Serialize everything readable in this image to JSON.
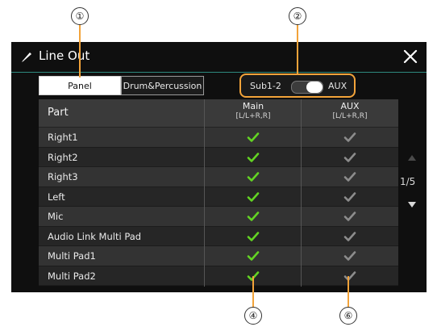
{
  "window": {
    "title": "Line Out",
    "title_icon": "pen-icon",
    "close_icon": "close-icon"
  },
  "tabs": [
    {
      "label": "Panel",
      "active": true
    },
    {
      "label": "Drum&Percussion",
      "active": false
    }
  ],
  "output_switch": {
    "left_label": "Sub1-2",
    "right_label": "AUX",
    "selected": "AUX"
  },
  "table": {
    "header_part": "Part",
    "columns": [
      {
        "title": "Main",
        "subtitle": "[L/L+R,R]"
      },
      {
        "title": "AUX",
        "subtitle": "[L/L+R,R]"
      }
    ],
    "rows": [
      {
        "part": "Right1",
        "main": true,
        "aux": false
      },
      {
        "part": "Right2",
        "main": true,
        "aux": false
      },
      {
        "part": "Right3",
        "main": true,
        "aux": false
      },
      {
        "part": "Left",
        "main": true,
        "aux": false
      },
      {
        "part": "Mic",
        "main": true,
        "aux": false
      },
      {
        "part": "Audio Link Multi Pad",
        "main": true,
        "aux": false
      },
      {
        "part": "Multi Pad1",
        "main": true,
        "aux": false
      },
      {
        "part": "Multi Pad2",
        "main": true,
        "aux": false
      }
    ]
  },
  "pager": {
    "page_text": "1/5"
  },
  "callouts": {
    "c1": "①",
    "c2": "②",
    "c3": "④",
    "c4": "⑥"
  },
  "colors": {
    "accent": "#f2a33a",
    "check_on": "#63d423",
    "check_off": "#8c8c8c",
    "title_rule": "#2e8a7e"
  }
}
